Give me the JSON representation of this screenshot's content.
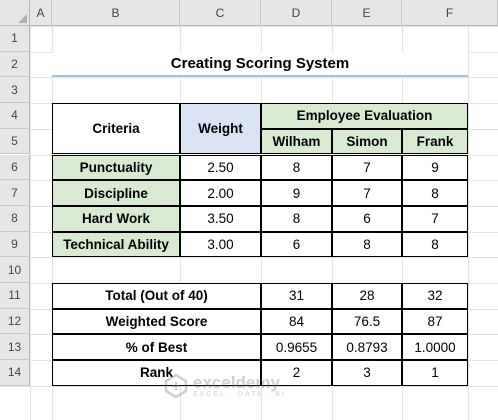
{
  "sheet": {
    "columns": [
      "A",
      "B",
      "C",
      "D",
      "E",
      "F"
    ],
    "rows": [
      "1",
      "2",
      "3",
      "4",
      "5",
      "6",
      "7",
      "8",
      "9",
      "10",
      "11",
      "12",
      "13",
      "14"
    ]
  },
  "title": "Creating Scoring System",
  "table1": {
    "criteria_header": "Criteria",
    "weight_header": "Weight",
    "evaluation_header": "Employee Evaluation",
    "employees": [
      "Wilham",
      "Simon",
      "Frank"
    ],
    "rows": [
      {
        "criteria": "Punctuality",
        "weight": "2.50",
        "scores": [
          "8",
          "7",
          "9"
        ]
      },
      {
        "criteria": "Discipline",
        "weight": "2.00",
        "scores": [
          "9",
          "7",
          "8"
        ]
      },
      {
        "criteria": "Hard Work",
        "weight": "3.50",
        "scores": [
          "8",
          "6",
          "7"
        ]
      },
      {
        "criteria": "Technical Ability",
        "weight": "3.00",
        "scores": [
          "6",
          "8",
          "8"
        ]
      }
    ]
  },
  "table2": {
    "rows": [
      {
        "label": "Total (Out of 40)",
        "values": [
          "31",
          "28",
          "32"
        ]
      },
      {
        "label": "Weighted Score",
        "values": [
          "84",
          "76.5",
          "87"
        ]
      },
      {
        "label": "% of Best",
        "values": [
          "0.9655",
          "0.8793",
          "1.0000"
        ]
      },
      {
        "label": "Rank",
        "values": [
          "2",
          "3",
          "1"
        ]
      }
    ]
  },
  "watermark": {
    "name": "exceldemy",
    "tagline": "EXCEL · DATA · BI"
  },
  "colors": {
    "green": "#d9ead3",
    "blue": "#dae3f3",
    "title_underline": "#a9bfdf"
  }
}
